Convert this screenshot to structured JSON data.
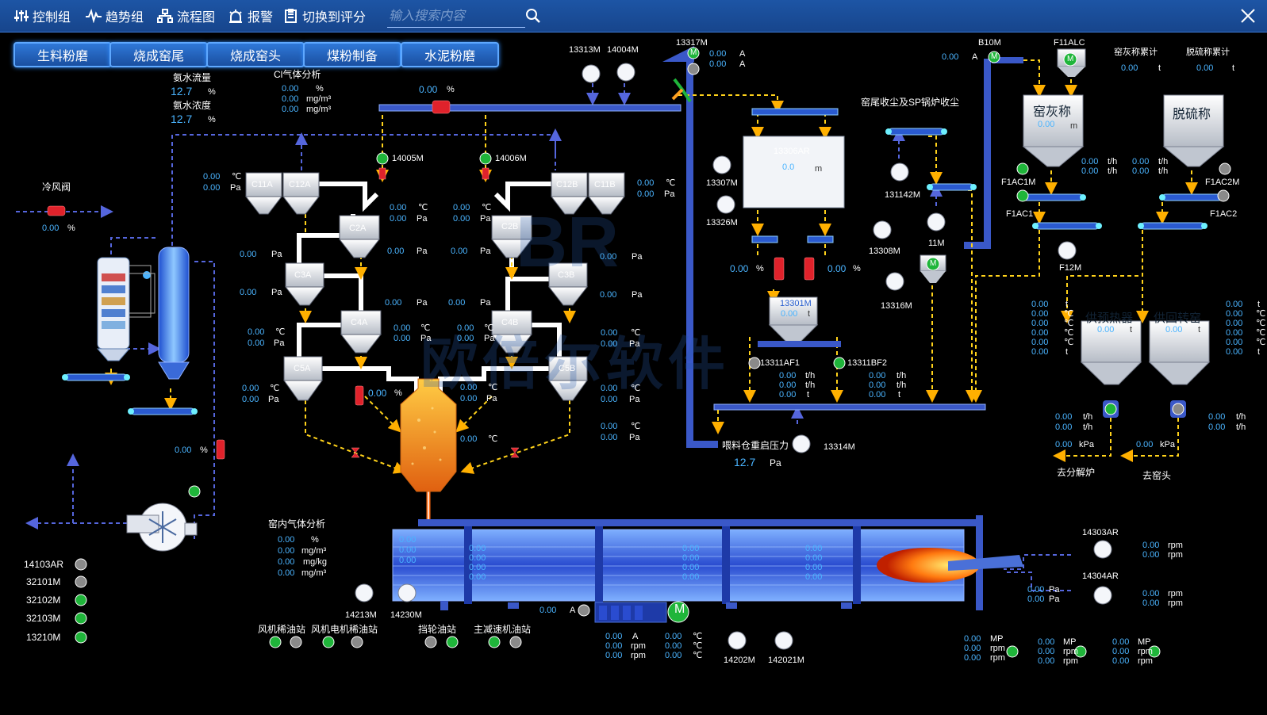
{
  "topbar": {
    "items": [
      "控制组",
      "趋势组",
      "流程图",
      "报警",
      "切换到评分"
    ],
    "search_placeholder": "输入搜索内容"
  },
  "tabs": [
    "生料粉磨",
    "烧成窑尾",
    "烧成窑头",
    "煤粉制备",
    "水泥粉磨"
  ],
  "watermark": {
    "logo": "BR",
    "text": "欧倍尔软件"
  },
  "left": {
    "ammonia_flow_label": "氨水流量",
    "ammonia_flow": "12.7",
    "ammonia_flow_unit": "%",
    "ammonia_conc_label": "氨水浓度",
    "ammonia_conc": "12.7",
    "ammonia_conc_unit": "%",
    "cold_valve_label": "冷风阀",
    "cold_valve_value": "0.00",
    "cold_valve_unit": "%",
    "valve_low": "0.00",
    "valve_low_unit": "%"
  },
  "cl_gas": {
    "title": "Cl气体分析",
    "rows": [
      [
        "0.00",
        "%"
      ],
      [
        "0.00",
        "mg/m³"
      ],
      [
        "0.00",
        "mg/m³"
      ]
    ]
  },
  "top_valve": {
    "value": "0.00",
    "unit": "%"
  },
  "motors_left": [
    {
      "id": "14103AR",
      "state": "off"
    },
    {
      "id": "32101M",
      "state": "off"
    },
    {
      "id": "32102M",
      "state": "on"
    },
    {
      "id": "32103M",
      "state": "on"
    },
    {
      "id": "13210M",
      "state": "on"
    }
  ],
  "cyclones": {
    "c11a": "C11A",
    "c12a": "C12A",
    "c12b": "C12B",
    "c11b": "C11B",
    "c2a": "C2A",
    "c2b": "C2B",
    "c3a": "C3A",
    "c3b": "C3B",
    "c4a": "C4A",
    "c4b": "C4B",
    "c5a": "C5A",
    "c5b": "C5B"
  },
  "motor_14005": "14005M",
  "motor_14006": "14006M",
  "readings": {
    "zero": "0.00",
    "degc": "℃",
    "pa": "Pa",
    "pct": "%",
    "t": "t",
    "th": "t/h",
    "kpa": "kPa",
    "rpm": "rpm",
    "mp": "MP",
    "a": "A",
    "m": "m"
  },
  "calciner_valve": "0.00",
  "kiln_gas": {
    "title": "窑内气体分析",
    "rows": [
      [
        "0.00",
        "%"
      ],
      [
        "0.00",
        "mg/m³"
      ],
      [
        "0.00",
        "mg/kg"
      ],
      [
        "0.00",
        "mg/m³"
      ]
    ]
  },
  "fans_bottom": {
    "f1": "14213M",
    "f2": "14230M",
    "f3": "14202M",
    "f4": "142021M"
  },
  "oil_stations": [
    "风机稀油站",
    "风机电机稀油站",
    "挡轮油站",
    "主减速机油站"
  ],
  "mid": {
    "m13313": "13313M",
    "m14004": "14004M",
    "m13317": "13317M",
    "hopper_13306": "13306AR",
    "hopper_13306_val": "0.0",
    "hopper_13306_unit": "m",
    "m13307": "13307M",
    "m13326": "13326M",
    "m13308": "13308M",
    "m13316": "13316M",
    "m131142": "131142M",
    "m11": "11M",
    "bin_13301": "13301M",
    "bin_13301_val": "0.00",
    "bin_13301_unit": "t",
    "m13311af1": "13311AF1",
    "m13311bf2": "13311BF2",
    "feed_pressure_label": "喂料仓重启压力",
    "feed_pressure": "12.7",
    "feed_pressure_unit": "Pa",
    "m13314": "13314M",
    "dust_label": "窑尾收尘及SP锅炉收尘"
  },
  "right": {
    "b10m": "B10M",
    "f11alc": "F11ALC",
    "ash_scale_acc": "窑灰称累计",
    "desulf_acc": "脱硫称累计",
    "ash_scale": "窑灰称",
    "ash_scale_val": "0.00",
    "ash_scale_unit": "m",
    "desulf_scale": "脱硫称",
    "f1ac1m": "F1AC1M",
    "f1ac2m": "F1AC2M",
    "f1ac1": "F1AC1",
    "f1ac2": "F1AC2",
    "f12m": "F12M",
    "preheater": "供预热器",
    "to_kiln": "供回转窑",
    "preheater_val": "0.00",
    "to_kiln_val": "0.00",
    "bin_unit": "t",
    "to_calciner": "去分解炉",
    "to_kiln_head": "去窑头",
    "m14303": "14303AR",
    "m14304": "14304AR"
  },
  "kiln_current_label": "A",
  "colors": {
    "bg": "#000000",
    "pipe": "#3a58c8",
    "value": "#4ab4ff",
    "motor_on": "#1fb53a",
    "motor_off": "#8a8a8a",
    "valve": "#e0222b",
    "flow": "#ffd21a"
  }
}
